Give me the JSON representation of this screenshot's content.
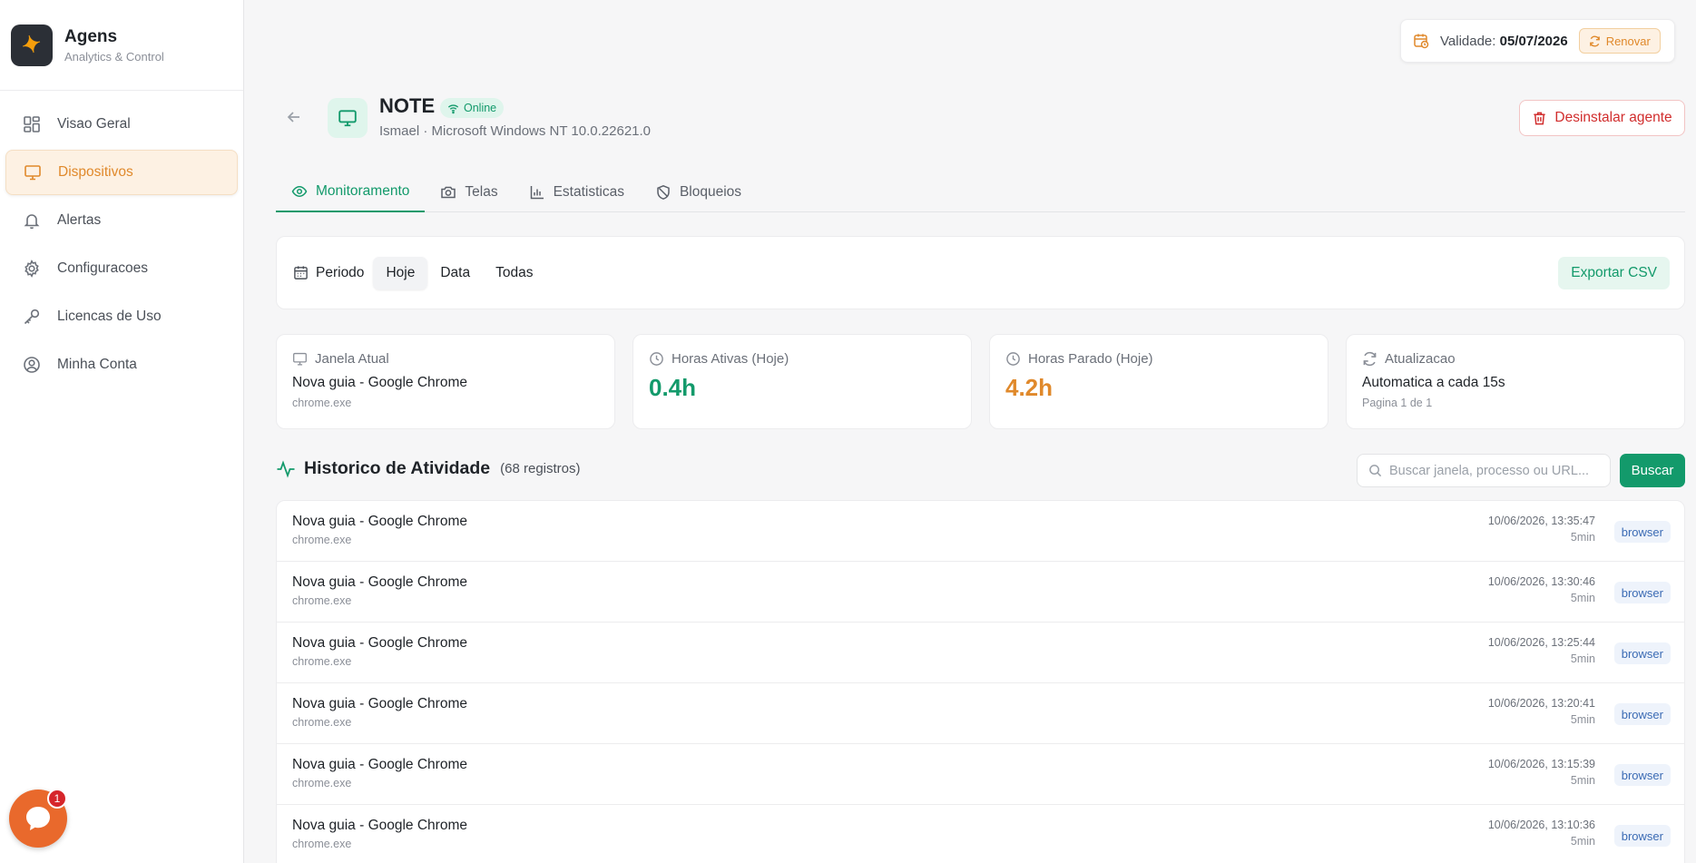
{
  "brand": {
    "name": "Agens",
    "subtitle": "Analytics & Control"
  },
  "sidebar": {
    "items": [
      {
        "label": "Visao Geral",
        "icon": "dashboard-icon",
        "active": false
      },
      {
        "label": "Dispositivos",
        "icon": "monitor-icon",
        "active": true
      },
      {
        "label": "Alertas",
        "icon": "bell-icon",
        "active": false
      },
      {
        "label": "Configuracoes",
        "icon": "gear-icon",
        "active": false
      },
      {
        "label": "Licencas de Uso",
        "icon": "key-icon",
        "active": false
      },
      {
        "label": "Minha Conta",
        "icon": "user-circle-icon",
        "active": false
      }
    ]
  },
  "chat": {
    "badge": "1"
  },
  "validity": {
    "label": "Validade:",
    "date": "05/07/2026",
    "renew_label": "Renovar"
  },
  "device": {
    "name": "NOTE",
    "status": "Online",
    "subtitle": "Ismael · Microsoft Windows NT 10.0.22621.0",
    "uninstall_label": "Desinstalar agente"
  },
  "tabs": [
    {
      "label": "Monitoramento",
      "icon": "eye-icon",
      "active": true
    },
    {
      "label": "Telas",
      "icon": "camera-icon",
      "active": false
    },
    {
      "label": "Estatisticas",
      "icon": "bar-chart-icon",
      "active": false
    },
    {
      "label": "Bloqueios",
      "icon": "shield-icon",
      "active": false
    }
  ],
  "period": {
    "label": "Periodo",
    "options": [
      {
        "label": "Hoje",
        "active": true
      },
      {
        "label": "Data",
        "active": false
      },
      {
        "label": "Todas",
        "active": false
      }
    ],
    "export_label": "Exportar CSV"
  },
  "stats": {
    "current_window": {
      "label": "Janela Atual",
      "value": "Nova guia - Google Chrome",
      "sub": "chrome.exe"
    },
    "active_hours": {
      "label": "Horas Ativas (Hoje)",
      "value": "0.4h"
    },
    "idle_hours": {
      "label": "Horas Parado (Hoje)",
      "value": "4.2h"
    },
    "update": {
      "label": "Atualizacao",
      "value": "Automatica a cada 15s",
      "sub": "Pagina 1 de 1"
    }
  },
  "history": {
    "title": "Historico de Atividade",
    "count": "(68 registros)",
    "search_placeholder": "Buscar janela, processo ou URL...",
    "search_button": "Buscar",
    "rows": [
      {
        "title": "Nova guia - Google Chrome",
        "process": "chrome.exe",
        "timestamp": "10/06/2026, 13:35:47",
        "duration": "5min",
        "category": "browser"
      },
      {
        "title": "Nova guia - Google Chrome",
        "process": "chrome.exe",
        "timestamp": "10/06/2026, 13:30:46",
        "duration": "5min",
        "category": "browser"
      },
      {
        "title": "Nova guia - Google Chrome",
        "process": "chrome.exe",
        "timestamp": "10/06/2026, 13:25:44",
        "duration": "5min",
        "category": "browser"
      },
      {
        "title": "Nova guia - Google Chrome",
        "process": "chrome.exe",
        "timestamp": "10/06/2026, 13:20:41",
        "duration": "5min",
        "category": "browser"
      },
      {
        "title": "Nova guia - Google Chrome",
        "process": "chrome.exe",
        "timestamp": "10/06/2026, 13:15:39",
        "duration": "5min",
        "category": "browser"
      },
      {
        "title": "Nova guia - Google Chrome",
        "process": "chrome.exe",
        "timestamp": "10/06/2026, 13:10:36",
        "duration": "5min",
        "category": "browser"
      }
    ]
  },
  "colors": {
    "accent_green": "#139a6b",
    "accent_orange": "#e0892b",
    "danger": "#d12d2d"
  }
}
